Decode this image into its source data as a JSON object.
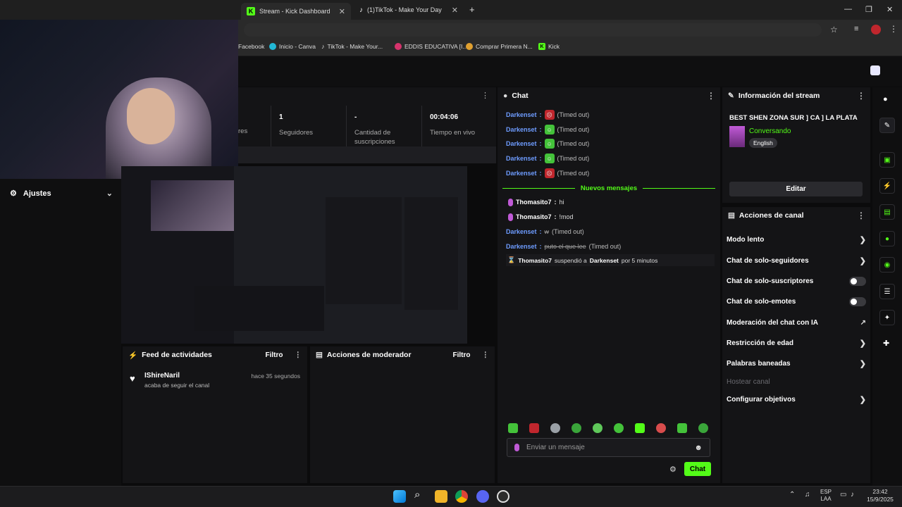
{
  "browser": {
    "tabs": [
      {
        "title": "Stream - Kick Dashboard",
        "active": true
      },
      {
        "title": "(1)TikTok - Make Your Day",
        "active": false
      }
    ],
    "bookmarks": [
      "Facebook",
      "Inicio - Canva",
      "TikTok - Make Your...",
      "EDDIS EDUCATIVA [I...",
      "Comprar Primera N...",
      "Kick"
    ]
  },
  "stats": [
    {
      "value": "",
      "label": "res"
    },
    {
      "value": "1",
      "label": "Seguidores"
    },
    {
      "value": "-",
      "label": "Cantidad de suscripciones"
    },
    {
      "value": "00:04:06",
      "label": "Tiempo en vivo"
    }
  ],
  "ajustes": {
    "label": "Ajustes"
  },
  "feed": {
    "title": "Feed de actividades",
    "filter": "Filtro",
    "items": [
      {
        "user": "IShireNaril",
        "text": "acaba de seguir el canal",
        "time": "hace 35 segundos"
      }
    ]
  },
  "moderator": {
    "title": "Acciones de moderador",
    "filter": "Filtro"
  },
  "chat": {
    "title": "Chat",
    "timed_out_lines": [
      {
        "user": "Darkenset",
        "text": "(Timed out)",
        "emote": "red"
      },
      {
        "user": "Darkenset",
        "text": "(Timed out)",
        "emote": "green"
      },
      {
        "user": "Darkenset",
        "text": "(Timed out)",
        "emote": "green"
      },
      {
        "user": "Darkenset",
        "text": "(Timed out)",
        "emote": "green"
      },
      {
        "user": "Darkenset",
        "text": "(Timed out)",
        "emote": "red"
      }
    ],
    "new_messages_label": "Nuevos mensajes",
    "messages": [
      {
        "user": "Thomasito7",
        "text": "hi"
      },
      {
        "user": "Thomasito7",
        "text": "!mod"
      }
    ],
    "deleted": [
      {
        "user": "Darkenset",
        "struck": "w",
        "note": "(Timed out)"
      },
      {
        "user": "Darkenset",
        "struck": "puto el que lee",
        "note": "(Timed out)"
      }
    ],
    "system": {
      "actor": "Thomasito7",
      "verb": "suspendió a",
      "target": "Darkenset",
      "duration": "por 5 minutos"
    },
    "input_placeholder": "Enviar un mensaje",
    "send_label": "Chat",
    "accent": "#53fc18"
  },
  "stream_info": {
    "title": "Información del stream",
    "stream_title": "BEST SHEN ZONA SUR ] CA ] LA PLATA",
    "category": "Conversando",
    "language": "English",
    "edit_label": "Editar"
  },
  "channel_actions": {
    "title": "Acciones de canal",
    "items": [
      {
        "label": "Modo lento",
        "control": "chevron"
      },
      {
        "label": "Chat de solo-seguidores",
        "control": "chevron"
      },
      {
        "label": "Chat de solo-suscriptores",
        "control": "toggle"
      },
      {
        "label": "Chat de solo-emotes",
        "control": "toggle"
      },
      {
        "label": "Moderación del chat con IA",
        "control": "external"
      },
      {
        "label": "Restricción de edad",
        "control": "chevron"
      },
      {
        "label": "Palabras baneadas",
        "control": "chevron"
      },
      {
        "label": "Hostear canal",
        "control": "disabled"
      },
      {
        "label": "Configurar objetivos",
        "control": "chevron"
      }
    ]
  },
  "taskbar": {
    "lang": "ESP",
    "lang2": "LAA",
    "time": "23:42",
    "date": "15/9/2025"
  }
}
